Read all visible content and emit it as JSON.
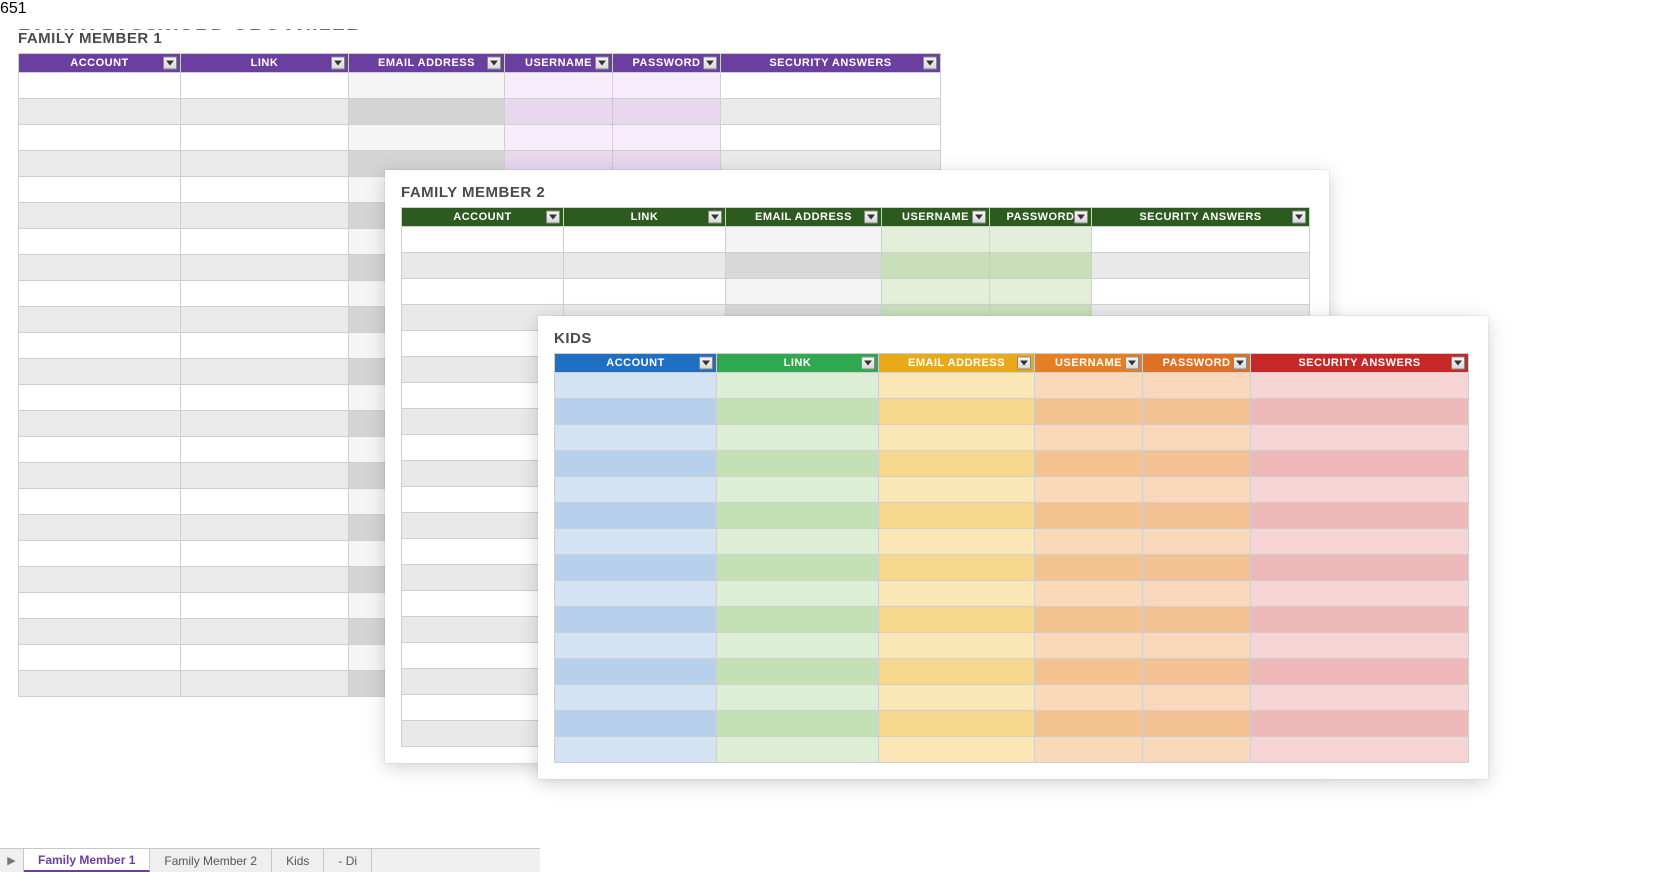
{
  "page_title": "FAMILY PASSWORD ORGANIZER",
  "columns": {
    "account": "ACCOUNT",
    "link": "LINK",
    "email": "EMAIL ADDRESS",
    "username": "USERNAME",
    "password": "PASSWORD",
    "security": "SECURITY ANSWERS"
  },
  "sheets": {
    "s1": {
      "title": "FAMILY MEMBER 1"
    },
    "s2": {
      "title": "FAMILY MEMBER 2"
    },
    "s3": {
      "title": "KIDS"
    }
  },
  "tabs": {
    "t1": "Family Member 1",
    "t2": "Family Member 2",
    "t3": "Kids",
    "t4": "- Di"
  }
}
